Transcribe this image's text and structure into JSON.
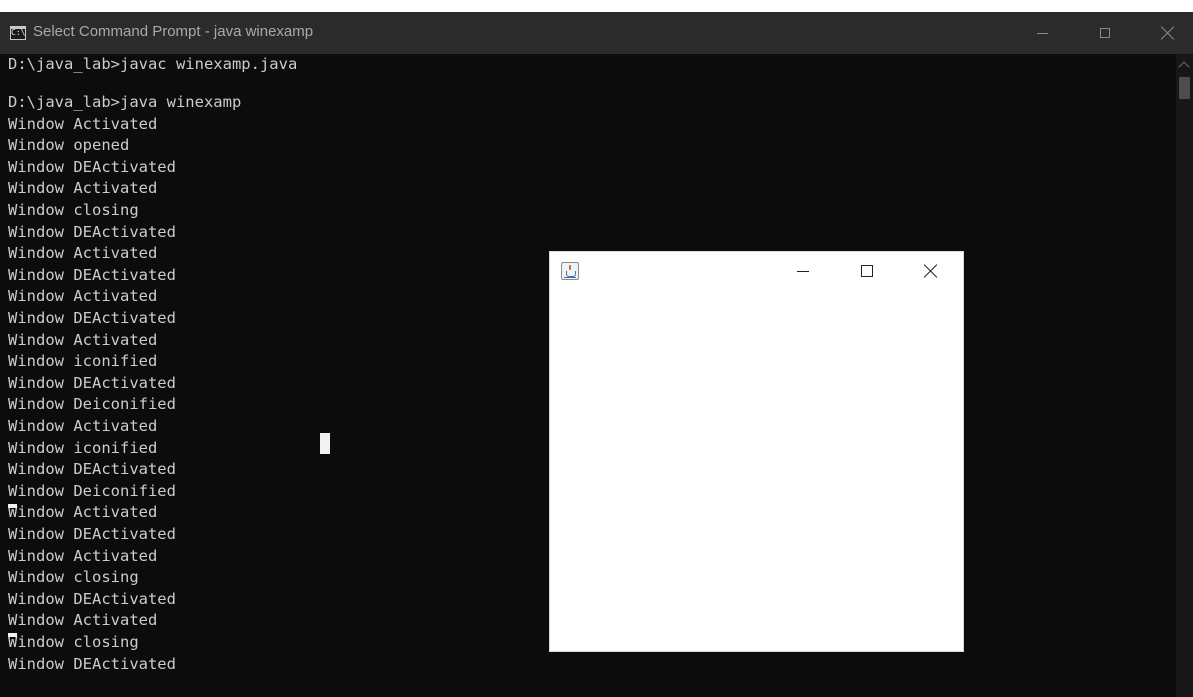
{
  "cmd_window": {
    "title": "Select Command Prompt - java  winexamp",
    "icon_text": "C:\\.",
    "icon": "console-icon",
    "buttons": {
      "minimize": "minimize-icon",
      "maximize": "maximize-icon",
      "close": "close-icon"
    },
    "colors": {
      "background": "#0c0c0c",
      "titlebar": "#2b2b2b",
      "text": "#cccccc"
    }
  },
  "console": {
    "lines": [
      "D:\\java_lab>javac winexamp.java",
      "",
      "D:\\java_lab>java winexamp",
      "Window Activated",
      "Window opened",
      "Window DEActivated",
      "Window Activated",
      "Window closing",
      "Window DEActivated",
      "Window Activated",
      "Window DEActivated",
      "Window Activated",
      "Window DEActivated",
      "Window Activated",
      "Window iconified",
      "Window DEActivated",
      "Window Deiconified",
      "Window Activated",
      "Window iconified",
      "Window DEActivated",
      "Window Deiconified",
      "Window Activated",
      "Window DEActivated",
      "Window Activated",
      "Window closing",
      "Window DEActivated",
      "Window Activated",
      "Window closing",
      "Window DEActivated"
    ]
  },
  "java_window": {
    "title": "",
    "icon": "java-icon",
    "buttons": {
      "minimize": "minimize-icon",
      "maximize": "maximize-icon",
      "close": "close-icon"
    },
    "background": "#ffffff"
  }
}
